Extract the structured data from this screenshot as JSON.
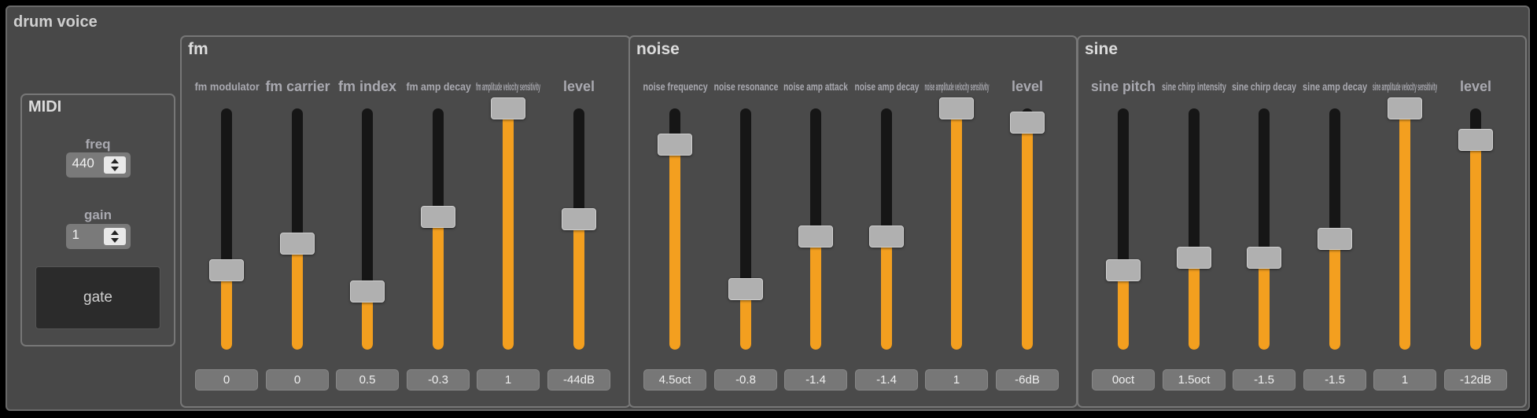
{
  "window": {
    "title": "drum voice"
  },
  "colors": {
    "fill": "#f39f1f",
    "track": "#161616",
    "panel": "#4a4a4a"
  },
  "midi": {
    "title": "MIDI",
    "freq": {
      "label": "freq",
      "value": "440"
    },
    "gain": {
      "label": "gain",
      "value": "1"
    },
    "gate_label": "gate"
  },
  "fm": {
    "title": "fm",
    "sliders": [
      {
        "label": "fm modulator",
        "value": "0",
        "level": 0.33
      },
      {
        "label": "fm carrier",
        "value": "0",
        "level": 0.44
      },
      {
        "label": "fm index",
        "value": "0.5",
        "level": 0.24
      },
      {
        "label": "fm amp decay",
        "value": "-0.3",
        "level": 0.55
      },
      {
        "label": "fm amplitude velocity sensitivity",
        "value": "1",
        "level": 1.0
      },
      {
        "label": "level",
        "value": "-44dB",
        "level": 0.54
      }
    ]
  },
  "noise": {
    "title": "noise",
    "sliders": [
      {
        "label": "noise frequency",
        "value": "4.5oct",
        "level": 0.85
      },
      {
        "label": "noise resonance",
        "value": "-0.8",
        "level": 0.25
      },
      {
        "label": "noise amp attack",
        "value": "-1.4",
        "level": 0.47
      },
      {
        "label": "noise amp decay",
        "value": "-1.4",
        "level": 0.47
      },
      {
        "label": "noise amplitude velocity sensitivity",
        "value": "1",
        "level": 1.0
      },
      {
        "label": "level",
        "value": "-6dB",
        "level": 0.94
      }
    ]
  },
  "sine": {
    "title": "sine",
    "sliders": [
      {
        "label": "sine pitch",
        "value": "0oct",
        "level": 0.33
      },
      {
        "label": "sine chirp intensity",
        "value": "1.5oct",
        "level": 0.38
      },
      {
        "label": "sine chirp decay",
        "value": "-1.5",
        "level": 0.38
      },
      {
        "label": "sine amp decay",
        "value": "-1.5",
        "level": 0.46
      },
      {
        "label": "sine amplitude velocity sensitivity",
        "value": "1",
        "level": 1.0
      },
      {
        "label": "level",
        "value": "-12dB",
        "level": 0.87
      }
    ]
  }
}
